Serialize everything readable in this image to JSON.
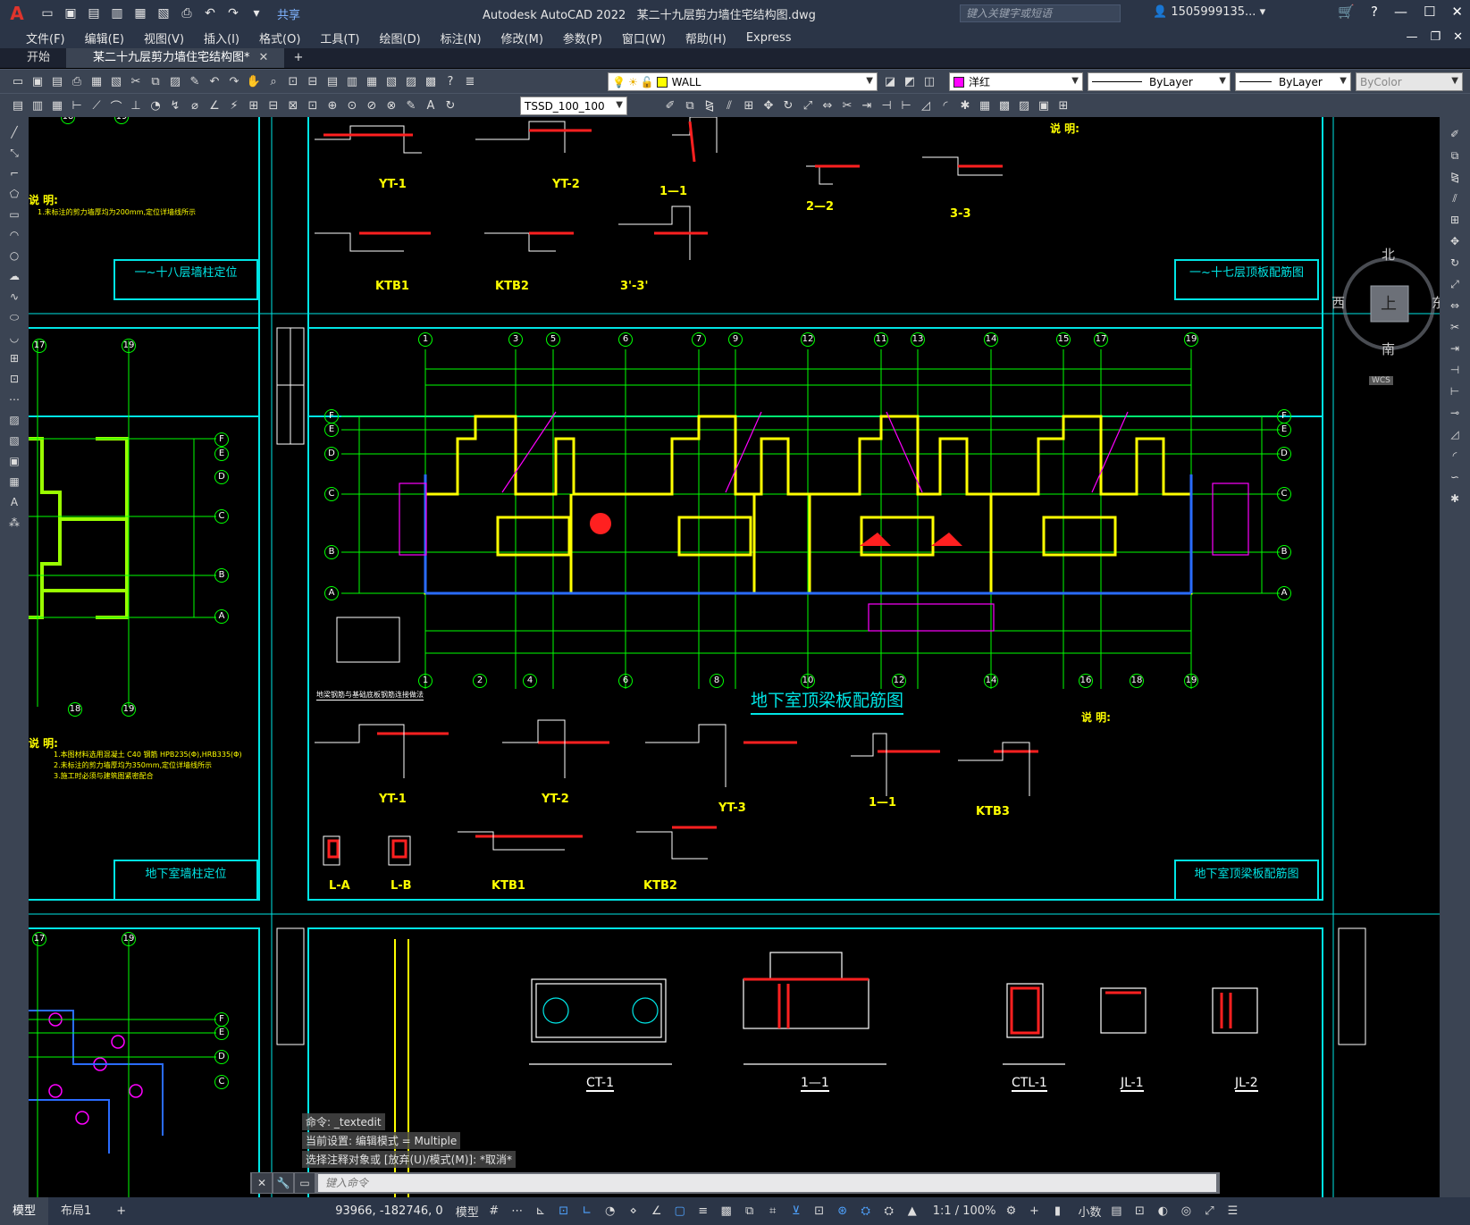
{
  "title_bar": {
    "app_title": "Autodesk AutoCAD 2022",
    "file_name": "某二十九层剪力墙住宅结构图.dwg",
    "share_label": "共享",
    "search_placeholder": "键入关键字或短语",
    "user": "1505999135..."
  },
  "menu": [
    "文件(F)",
    "编辑(E)",
    "视图(V)",
    "插入(I)",
    "格式(O)",
    "工具(T)",
    "绘图(D)",
    "标注(N)",
    "修改(M)",
    "参数(P)",
    "窗口(W)",
    "帮助(H)",
    "Express"
  ],
  "tabs": [
    {
      "label": "开始"
    },
    {
      "label": "某二十九层剪力墙住宅结构图*"
    }
  ],
  "layer_combo": "WALL",
  "color_combo": "洋红",
  "linetype_combo": "ByLayer",
  "lineweight_combo": "ByLayer",
  "plotstyle_combo": "ByColor",
  "dimstyle_combo": "TSSD_100_100",
  "viewcube": {
    "north": "北",
    "south": "南",
    "east": "东",
    "west": "西",
    "top": "上",
    "wcs": "WCS"
  },
  "drawing": {
    "main_title": "地下室顶梁板配筋图",
    "panel_titles": {
      "top_left": "一~十八层墙柱定位",
      "top_right": "一~十七层顶板配筋图",
      "mid_left": "地下室墙柱定位",
      "mid_right": "地下室顶梁板配筋图"
    },
    "notes_label": "说 明:",
    "top_left_note": "1.未标注的剪力墙厚均为200mm,定位详墙线所示",
    "mid_left_notes": [
      "1.本图材料选用混凝土 C40 钢筋 HPB235(Φ),HRB335(Φ)",
      "2.未标注的剪力墙厚均为350mm,定位详墙线所示",
      "3.施工时必须与建筑图紧密配合"
    ],
    "top_row_labels": [
      "YT-1",
      "YT-2",
      "1—1",
      "2—2",
      "3-3",
      "KTB1",
      "KTB2",
      "3'-3'"
    ],
    "mid_row_labels": [
      "YT-1",
      "YT-2",
      "YT-3",
      "1—1",
      "KTB3",
      "L-A",
      "L-B",
      "KTB1",
      "KTB2"
    ],
    "bottom_labels": [
      "CT-1",
      "1—1",
      "CTL-1",
      "JL-1",
      "JL-2"
    ],
    "axis_top": [
      "1",
      "3",
      "5",
      "6",
      "7",
      "9",
      "12",
      "11",
      "13",
      "14",
      "15",
      "17",
      "19"
    ],
    "axis_bottom": [
      "1",
      "2",
      "4",
      "6",
      "8",
      "10",
      "12",
      "14",
      "16",
      "18",
      "19"
    ],
    "axis_side": [
      "F",
      "E",
      "D",
      "C",
      "B",
      "A"
    ],
    "mini_axes": [
      "17",
      "19",
      "18"
    ],
    "detail_caption": "地梁钢筋与基础底板钢筋连接做法"
  },
  "command": {
    "history": [
      "命令: _textedit",
      "当前设置: 编辑模式 = Multiple",
      "选择注释对象或 [放弃(U)/模式(M)]: *取消*"
    ],
    "placeholder": "键入命令"
  },
  "status": {
    "layout_tabs": [
      "模型",
      "布局1"
    ],
    "coords": "93966, -182746, 0",
    "model_label": "模型",
    "scale": "1:1 / 100%",
    "units": "小数"
  },
  "colors": {
    "title_bg": "#2b3547",
    "toolbar_bg": "#3b4453",
    "wall_yellow": "#ffff00",
    "axis_green": "#00ff00",
    "frame_cyan": "#00e5e5",
    "rebar_red": "#ff2020",
    "magenta": "#ff00ff",
    "blue": "#2a6cff"
  }
}
